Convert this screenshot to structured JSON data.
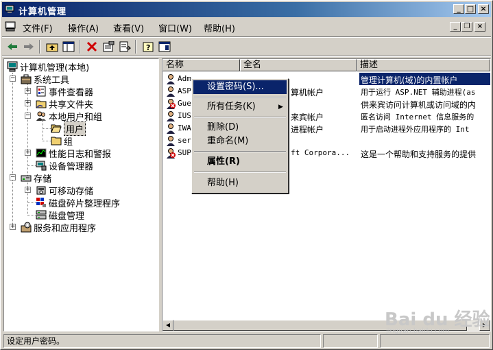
{
  "window": {
    "title": "计算机管理"
  },
  "menubar": {
    "items": [
      {
        "label": "文件(F)"
      },
      {
        "label": "操作(A)"
      },
      {
        "label": "查看(V)"
      },
      {
        "label": "窗口(W)"
      },
      {
        "label": "帮助(H)"
      }
    ]
  },
  "tree": {
    "root": "计算机管理(本地)",
    "system_tools": "系统工具",
    "event_viewer": "事件查看器",
    "shared_folders": "共享文件夹",
    "local_users_groups": "本地用户和组",
    "users": "用户",
    "groups": "组",
    "perf_logs": "性能日志和警报",
    "device_manager": "设备管理器",
    "storage": "存储",
    "removable_storage": "可移动存储",
    "defrag": "磁盘碎片整理程序",
    "disk_mgmt": "磁盘管理",
    "services_apps": "服务和应用程序"
  },
  "list": {
    "columns": [
      "名称",
      "全名",
      "描述"
    ],
    "rows": [
      {
        "name": "Adm",
        "fullname": "",
        "desc": "管理计算机(域)的内置帐户"
      },
      {
        "name": "ASP",
        "fullname": "算机帐户",
        "desc": "用于运行 ASP.NET 辅助进程(as"
      },
      {
        "name": "Gue",
        "fullname": "",
        "desc": "供来宾访问计算机或访问域的内"
      },
      {
        "name": "IUS",
        "fullname": "来宾帐户",
        "desc": "匿名访问 Internet 信息服务的"
      },
      {
        "name": "IWA",
        "fullname": "进程帐户",
        "desc": "用于启动进程外应用程序的 Int"
      },
      {
        "name": "ser",
        "fullname": "",
        "desc": ""
      },
      {
        "name": "SUP",
        "fullname": "ft Corpora...",
        "desc": "这是一个帮助和支持服务的提供"
      }
    ]
  },
  "context_menu": {
    "set_password": "设置密码(S)...",
    "all_tasks": "所有任务(K)",
    "submenu_arrow": "▶",
    "delete": "删除(D)",
    "rename": "重命名(M)",
    "properties": "属性(R)",
    "help": "帮助(H)"
  },
  "status": {
    "text": "设定用户密码。"
  },
  "watermark": {
    "logo": "Bai du 经验",
    "url": "jingyan.baidu.com"
  },
  "colors": {
    "title_start": "#0a246a",
    "title_end": "#a6caf0",
    "selection": "#0a246a",
    "face": "#d4d0c8"
  }
}
